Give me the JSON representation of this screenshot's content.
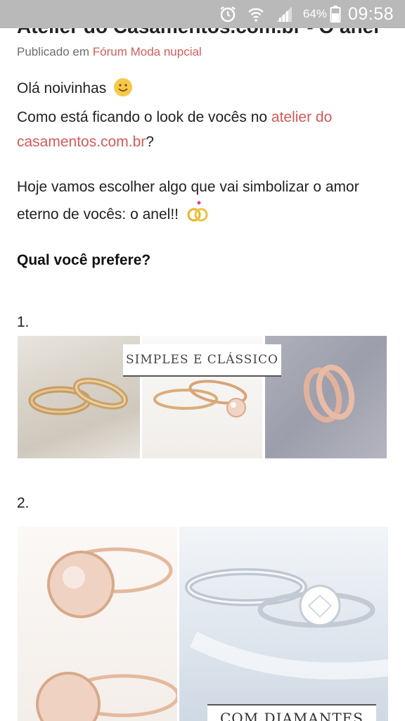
{
  "status_bar": {
    "battery_percent": "64%",
    "time": "09:58",
    "icons": [
      "alarm-icon",
      "wifi-icon",
      "signal-icon",
      "battery-icon"
    ]
  },
  "post": {
    "title_partial": "Atelier do Casamentos.com.br - O anel",
    "published_prefix": "Publicado em",
    "published_forum": "Fórum Moda nupcial",
    "greeting": "Olá noivinhas",
    "line2_prefix": "Como está ficando o look de vocês no",
    "line2_link": "atelier do casamentos.com.br",
    "line2_suffix": "?",
    "para2": "Hoje vamos escolher algo que vai simbolizar o amor eterno de vocês: o anel!!",
    "question": "Qual você prefere?",
    "option1_number": "1.",
    "option1_banner": "SIMPLES E CLÁSSICO",
    "option2_number": "2.",
    "option2_banner": "COM DIAMANTES"
  },
  "colors": {
    "status_bar_bg": "#b9b9b9",
    "link": "#d45a5a"
  }
}
